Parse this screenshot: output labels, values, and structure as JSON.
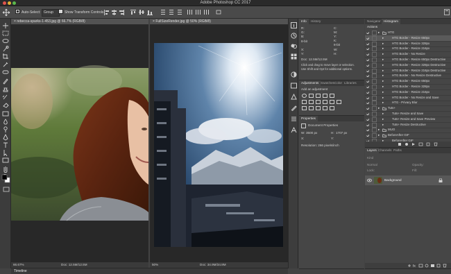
{
  "app": {
    "title": "Adobe Photoshop CC 2017"
  },
  "options_bar": {
    "auto_select_label": "Auto-Select:",
    "auto_select_value": "Group",
    "show_transform_label": "Show Transform Controls"
  },
  "documents": [
    {
      "tab_label": "rebecca-sparks-1-453.jpg @ 66.7% (RGB/8)",
      "zoom": "66.67%",
      "doc_size": "Doc: 12.5M/12.5M"
    },
    {
      "tab_label": "FullSizeRender.jpg @ 50% (RGB/8)",
      "zoom": "50%",
      "doc_size": "Doc: 34.9M/34.9M"
    }
  ],
  "timeline_label": "Timeline",
  "info_panel": {
    "tabs": [
      "Info",
      "History"
    ],
    "r": "R:",
    "g": "G:",
    "b": "B:",
    "bitdepth_left": "8-bit",
    "c": "C:",
    "m": "M:",
    "y": "Y:",
    "k": "K:",
    "bitdepth_right": "8-bit",
    "x": "X:",
    "y_coord": "Y:",
    "w": "W:",
    "h": "H:",
    "doc_size": "Doc: 12.5M/12.5M",
    "hint_line1": "Click and drag to move layer or selection.",
    "hint_line2": "Use Shift and Opt for additional options."
  },
  "adjustments_panel": {
    "tabs": [
      "Adjustments",
      "Swatches",
      "Color",
      "Libraries"
    ],
    "heading": "Add an adjustment"
  },
  "properties_panel": {
    "title": "Properties",
    "subtitle": "Document Properties",
    "w_label": "W:",
    "w_value": "3500 px",
    "h_label": "H:",
    "h_value": "1707 px",
    "x_label": "X:",
    "y_label": "Y:",
    "resolution": "Resolution: 266 pixels/inch"
  },
  "actions_panel": {
    "tabs": [
      "Navigator",
      "Histogram"
    ],
    "header": "Actions",
    "rows": [
      {
        "label": "HTG",
        "type": "set",
        "indent": 0
      },
      {
        "label": "HTG Border - Resize 650px",
        "type": "action",
        "indent": 1,
        "selected": true
      },
      {
        "label": "HTG Border - Resize 328px",
        "type": "action",
        "indent": 1
      },
      {
        "label": "HTG Border - Resize 216px",
        "type": "action",
        "indent": 1
      },
      {
        "label": "HTG Border - No Resize",
        "type": "action",
        "indent": 1
      },
      {
        "label": "HTG Border - Resize 650px Destructive",
        "type": "action",
        "indent": 1
      },
      {
        "label": "HTG Border - Resize 328px Destructive",
        "type": "action",
        "indent": 1
      },
      {
        "label": "HTG Border - Resize 216px Destructive",
        "type": "action",
        "indent": 1
      },
      {
        "label": "HTG Border - No Resize Destructive",
        "type": "action",
        "indent": 1
      },
      {
        "label": "HTG Border - Resize 650px",
        "type": "action",
        "indent": 1
      },
      {
        "label": "HTG Border - Resize 328px",
        "type": "action",
        "indent": 1
      },
      {
        "label": "HTG Border - Resize 216px",
        "type": "action",
        "indent": 1
      },
      {
        "label": "HTG Border - No Resize and Save",
        "type": "action",
        "indent": 1
      },
      {
        "label": "HTG - Privacy Blur",
        "type": "action",
        "indent": 1
      },
      {
        "label": "Tuts+",
        "type": "set",
        "indent": 0
      },
      {
        "label": "Tuts+ Resize and Save",
        "type": "action",
        "indent": 1
      },
      {
        "label": "Tuts+ Resize and Save Preview",
        "type": "action",
        "indent": 1
      },
      {
        "label": "Tuts+ Resize Destructive",
        "type": "action",
        "indent": 1
      },
      {
        "label": "MUO",
        "type": "set",
        "indent": 0
      },
      {
        "label": "BeforeAfter GIF",
        "type": "set",
        "indent": 0
      },
      {
        "label": "BeforeAfter GIF",
        "type": "action",
        "indent": 1
      }
    ]
  },
  "layers_panel": {
    "tabs": [
      "Layers",
      "Channels",
      "Paths"
    ],
    "kind_label": "Kind",
    "blend_mode": "Normal",
    "opacity_label": "Opacity:",
    "lock_label": "Lock:",
    "fill_label": "Fill:",
    "layer_name": "Background"
  },
  "colors": {
    "ui_dark": "#2a2a2a",
    "ui_mid": "#464646",
    "selection": "#5a5a5a"
  }
}
